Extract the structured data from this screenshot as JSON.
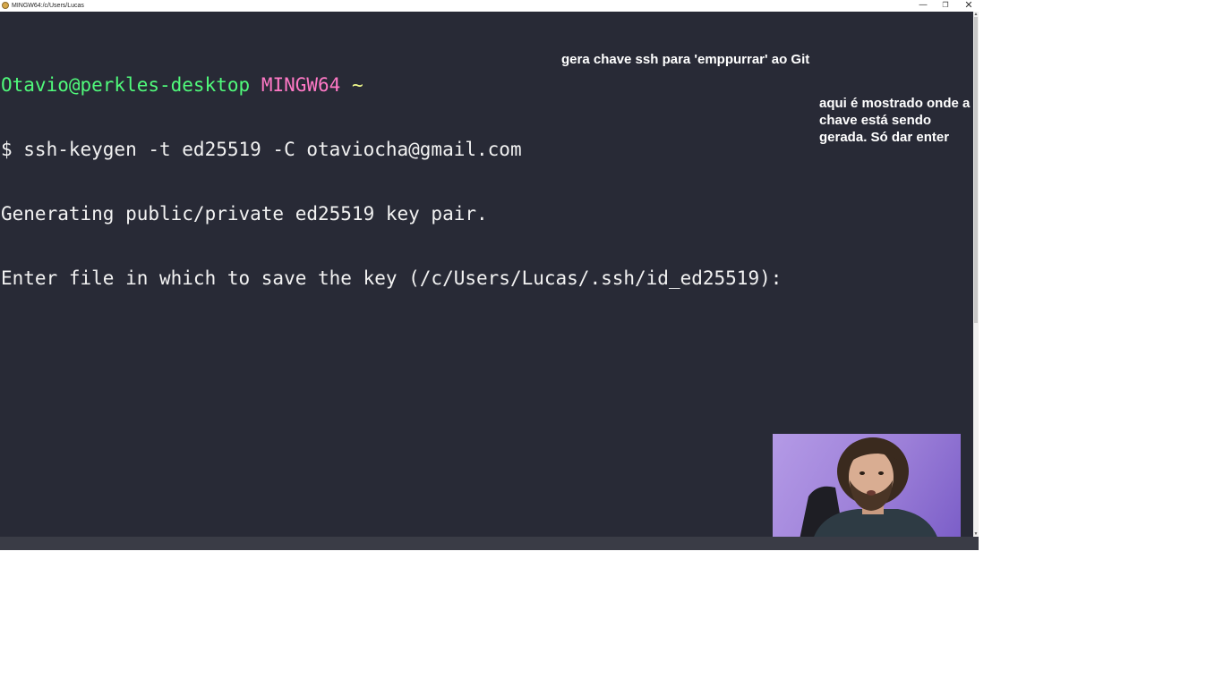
{
  "window": {
    "title": "MINGW64:/c/Users/Lucas",
    "minimize_glyph": "—",
    "maximize_glyph": "❐",
    "close_glyph": "✕"
  },
  "terminal": {
    "prompt_user": "Otavio@perkles-desktop",
    "prompt_system": "MINGW64",
    "prompt_path": "~",
    "command_line": "$ ssh-keygen -t ed25519 -C otaviocha@gmail.com",
    "output_line_1": "Generating public/private ed25519 key pair.",
    "output_line_2": "Enter file in which to save the key (/c/Users/Lucas/.ssh/id_ed25519): "
  },
  "annotations": {
    "note_1": "gera chave ssh para 'emppurrar' ao Git",
    "note_2": "aqui é mostrado onde a\nchave está sendo\ngerada. Só dar enter"
  },
  "colors": {
    "terminal_bg": "#282a36",
    "prompt_user": "#50fa7b",
    "prompt_system": "#ff79c6",
    "prompt_path": "#f1fa8c",
    "text": "#f2f2f2"
  },
  "icons": {
    "app": "git-bash-icon",
    "scroll_up": "arrow-up-icon",
    "scroll_down": "arrow-down-icon"
  }
}
